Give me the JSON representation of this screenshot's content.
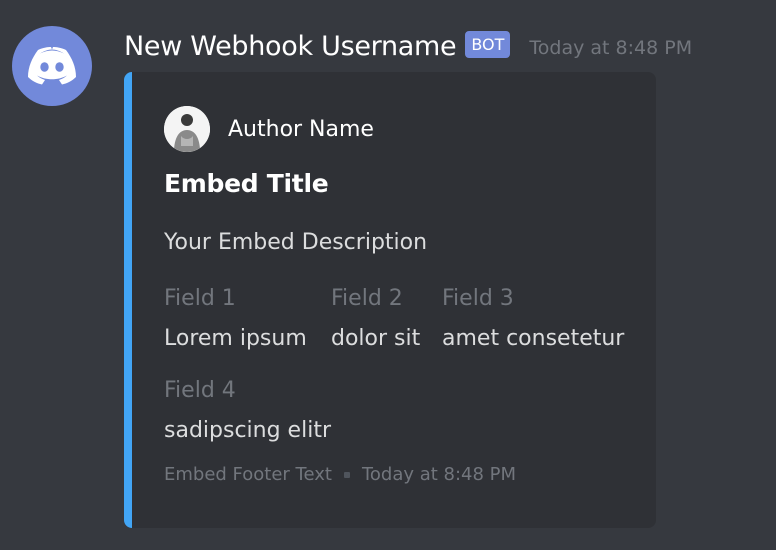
{
  "message": {
    "username": "New Webhook Username",
    "bot_tag": "BOT",
    "timestamp": "Today at 8:48 PM",
    "avatar_icon": "discord-logo-icon"
  },
  "embed": {
    "color": "#42a5f5",
    "author": {
      "name": "Author Name",
      "icon": "author-avatar-icon"
    },
    "title": "Embed Title",
    "description": "Your Embed Description",
    "fields": [
      {
        "name": "Field 1",
        "value": "Lorem ipsum"
      },
      {
        "name": "Field 2",
        "value": "dolor sit"
      },
      {
        "name": "Field 3",
        "value": "amet consetetur"
      },
      {
        "name": "Field 4",
        "value": "sadipscing elitr"
      }
    ],
    "footer": {
      "text": "Embed Footer Text",
      "timestamp": "Today at 8:48 PM"
    }
  },
  "colors": {
    "background": "#36393f",
    "embed_background": "#2f3136",
    "blurple": "#7289da",
    "text_primary": "#ffffff",
    "text_muted": "#72767d"
  }
}
